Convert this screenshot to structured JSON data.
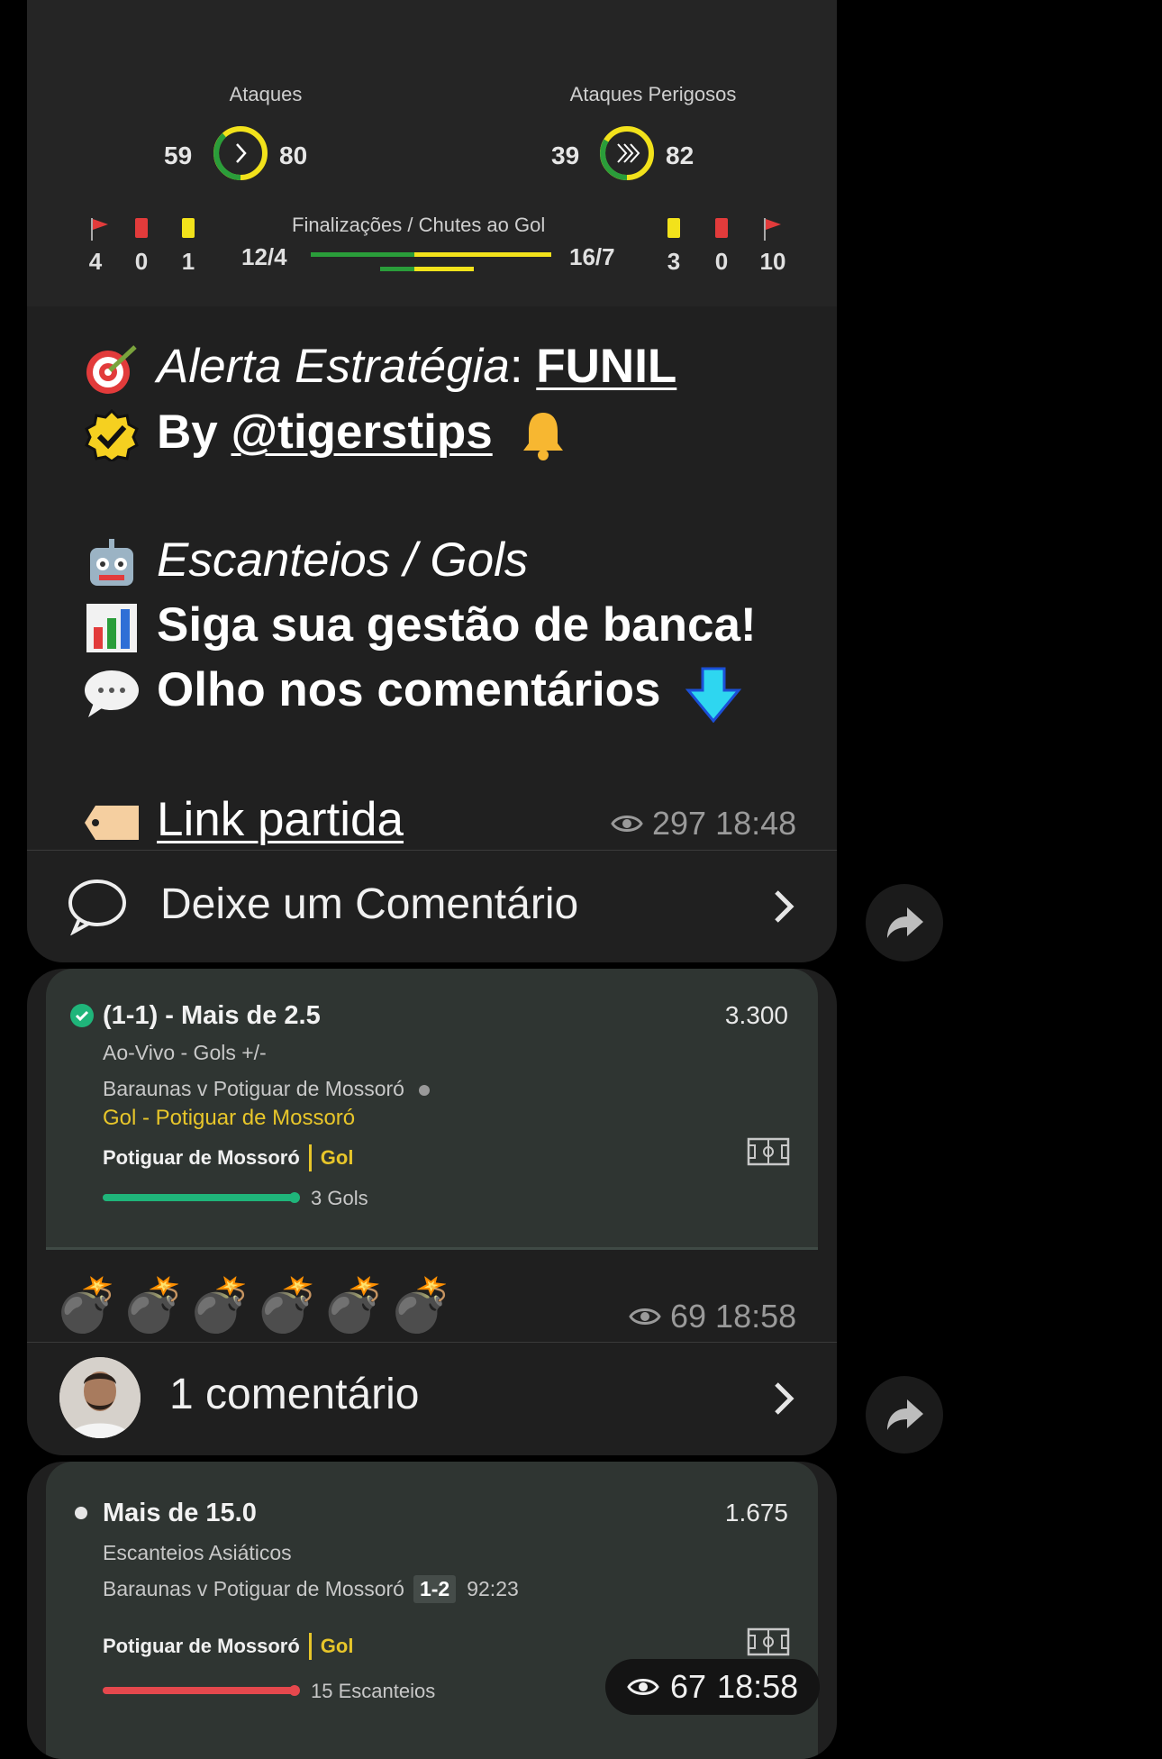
{
  "stats": {
    "attacks_label": "Ataques",
    "attacks_home": "59",
    "attacks_away": "80",
    "dangerous_label": "Ataques Perigosos",
    "dangerous_home": "39",
    "dangerous_away": "82",
    "shots_label": "Finalizações / Chutes ao Gol",
    "shots_home": "12/4",
    "shots_away": "16/7",
    "home_corners": "4",
    "home_red": "0",
    "home_yellow": "1",
    "away_yellow": "3",
    "away_red": "0",
    "away_corners": "10",
    "colors": {
      "home": "#2a9d3a",
      "away": "#f2e21b",
      "red_card": "#e23b3b"
    }
  },
  "message1": {
    "line1_prefix": "Alerta Estratégia",
    "line1_sep": ": ",
    "line1_link": "FUNIL",
    "line2_prefix": "By ",
    "line2_link": "@tigerstips",
    "line3": "Escanteios / Gols",
    "line4": "Siga sua gestão de banca!",
    "line5": "Olho nos comentários",
    "line6_link": "Link partida",
    "views": "297",
    "time": "18:48",
    "comment_label": "Deixe um Comentário"
  },
  "bet1": {
    "title": "(1-1) - Mais de 2.5",
    "odd": "3.300",
    "market": "Ao-Vivo - Gols +/-",
    "match": "Baraunas v Potiguar de Mossoró",
    "event": "Gol - Potiguar de Mossoró",
    "team": "Potiguar de Mossoró",
    "tag": "Gol",
    "progress_label": "3 Gols",
    "progress": 1.0,
    "progress_color": "#1fb57a",
    "reaction": "💣💣💣💣💣💣",
    "views": "69",
    "time": "18:58",
    "comments_label": "1 comentário"
  },
  "bet2": {
    "title": "Mais de 15.0",
    "odd": "1.675",
    "market": "Escanteios Asiáticos",
    "match": "Baraunas v Potiguar de Mossoró",
    "score": "1-2",
    "clock": "92:23",
    "team": "Potiguar de Mossoró",
    "tag": "Gol",
    "progress_label": "15 Escanteios",
    "progress": 1.0,
    "progress_color": "#e5484d",
    "views": "67",
    "time": "18:58"
  }
}
